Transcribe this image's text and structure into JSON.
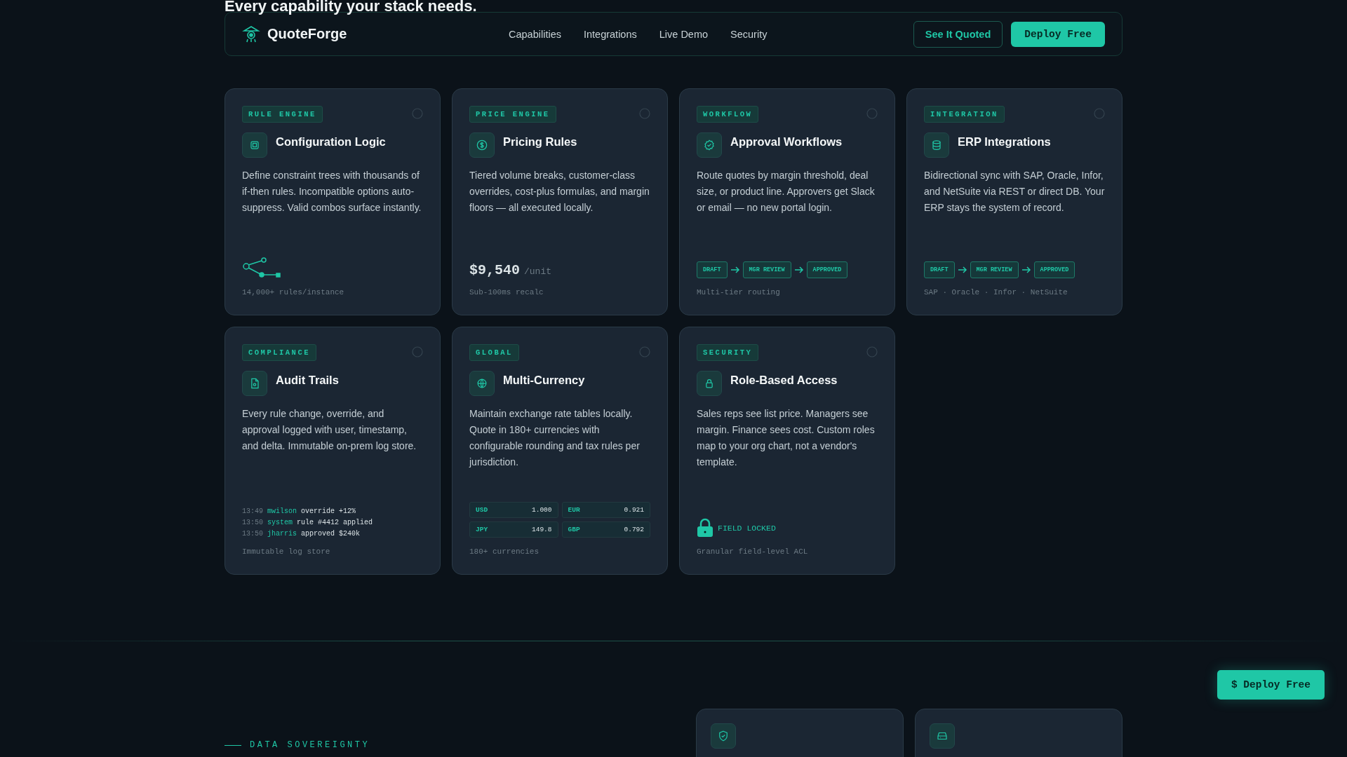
{
  "heading": "Every capability your stack needs.",
  "nav": {
    "brand": "QuoteForge",
    "links": [
      "Capabilities",
      "Integrations",
      "Live Demo",
      "Security"
    ],
    "secondary_button": "See It Quoted",
    "primary_button": "Deploy Free"
  },
  "cards": [
    {
      "tag": "RULE ENGINE",
      "title": "Configuration Logic",
      "description": "Define constraint trees with thousands of if-then rules. Incompatible options auto-suppress. Valid combos surface instantly.",
      "kind": "tree",
      "caption": "14,000+ rules/instance"
    },
    {
      "tag": "PRICE ENGINE",
      "title": "Pricing Rules",
      "description": "Tiered volume breaks, customer-class overrides, cost-plus formulas, and margin floors — all executed locally.",
      "kind": "price",
      "price": "$9,540",
      "unit": "/unit",
      "caption": "Sub-100ms recalc"
    },
    {
      "tag": "WORKFLOW",
      "title": "Approval Workflows",
      "description": "Route quotes by margin threshold, deal size, or product line. Approvers get Slack or email — no new portal login.",
      "kind": "flow",
      "steps": [
        "DRAFT",
        "MGR REVIEW",
        "APPROVED"
      ],
      "caption": "Multi-tier routing"
    },
    {
      "tag": "INTEGRATION",
      "title": "ERP Integrations",
      "description": "Bidirectional sync with SAP, Oracle, Infor, and NetSuite via REST or direct DB. Your ERP stays the system of record.",
      "kind": "flow",
      "steps": [
        "DRAFT",
        "MGR REVIEW",
        "APPROVED"
      ],
      "caption": "SAP · Oracle · Infor · NetSuite"
    },
    {
      "tag": "COMPLIANCE",
      "title": "Audit Trails",
      "description": "Every rule change, override, and approval logged with user, timestamp, and delta. Immutable on-prem log store.",
      "kind": "log",
      "log": [
        {
          "time": "13:49",
          "user": "mwilson",
          "action": "override +12%"
        },
        {
          "time": "13:50",
          "user": "system",
          "action": "rule #4412 applied"
        },
        {
          "time": "13:50",
          "user": "jharris",
          "action": "approved $240k"
        }
      ],
      "caption": "Immutable log store"
    },
    {
      "tag": "GLOBAL",
      "title": "Multi-Currency",
      "description": "Maintain exchange rate tables locally. Quote in 180+ currencies with configurable rounding and tax rules per jurisdiction.",
      "kind": "rates",
      "rates": [
        {
          "code": "USD",
          "rate": "1.000"
        },
        {
          "code": "EUR",
          "rate": "0.921"
        },
        {
          "code": "JPY",
          "rate": "149.8"
        },
        {
          "code": "GBP",
          "rate": "0.792"
        }
      ],
      "caption": "180+ currencies"
    },
    {
      "tag": "SECURITY",
      "title": "Role-Based Access",
      "description": "Sales reps see list price. Managers see margin. Finance sees cost. Custom roles map to your org chart, not a vendor's template.",
      "kind": "lock",
      "lock_label": "FIELD LOCKED",
      "caption": "Granular field-level ACL"
    }
  ],
  "floating_button": "$ Deploy Free",
  "next_section": {
    "eyebrow": "DATA SOVEREIGNTY"
  }
}
